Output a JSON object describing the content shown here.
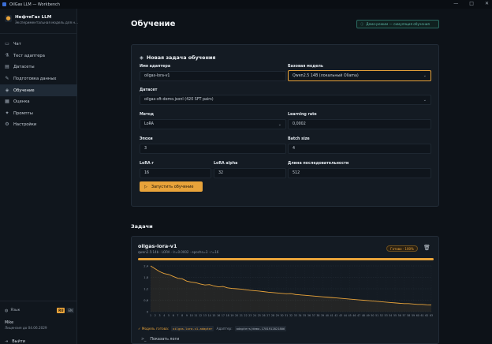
{
  "window": {
    "title": "OilGas LLM — Workbench",
    "controls": [
      "—",
      "□",
      "✕"
    ]
  },
  "brand": {
    "name": "НефтеГаз LLM",
    "subtitle": "Экспериментальная модель для н..."
  },
  "sidebar": {
    "items": [
      {
        "label": "Чат",
        "icon": "chat-icon",
        "active": false
      },
      {
        "label": "Тест адаптера",
        "icon": "beaker-icon",
        "active": false
      },
      {
        "label": "Датасеты",
        "icon": "database-icon",
        "active": false
      },
      {
        "label": "Подготовка данных",
        "icon": "wrench-icon",
        "active": false
      },
      {
        "label": "Обучение",
        "icon": "graduation-icon",
        "active": true
      },
      {
        "label": "Оценка",
        "icon": "chart-icon",
        "active": false
      },
      {
        "label": "Промпты",
        "icon": "prompt-icon",
        "active": false
      },
      {
        "label": "Настройки",
        "icon": "gear-icon",
        "active": false
      }
    ],
    "language_label": "Язык",
    "languages": [
      {
        "code": "RU",
        "active": true
      },
      {
        "code": "EN",
        "active": false
      }
    ],
    "user_name": "Mike",
    "license": "Лицензия до 04.06.2029",
    "logout_label": "Выйти"
  },
  "page": {
    "title": "Обучение",
    "demo_badge": "Демо-режим — симуляция обучения"
  },
  "form": {
    "title": "Новая задача обучения",
    "adapter_name_label": "Имя адаптера",
    "adapter_name_value": "oilgas-lora-v1",
    "base_model_label": "Базовая модель",
    "base_model_value": "Qwen2.5 14B (локальный Ollama)",
    "dataset_label": "Датасет",
    "dataset_value": "oilgas-sft-demo.jsonl (420 SFT pairs)",
    "method_label": "Метод",
    "method_value": "LoRA",
    "lr_label": "Learning rate",
    "lr_value": "0,0002",
    "epochs_label": "Эпохи",
    "epochs_value": "3",
    "batch_label": "Batch size",
    "batch_value": "4",
    "lora_r_label": "LoRA r",
    "lora_r_value": "16",
    "lora_alpha_label": "LoRA alpha",
    "lora_alpha_value": "32",
    "seq_len_label": "Длина последовательности",
    "seq_len_value": "512",
    "start_button": "Запустить обучение"
  },
  "jobs": {
    "title": "Задачи",
    "items": [
      {
        "name": "oilgas-lora-v1",
        "meta": "qwen2.5:14b · LORA · lr=0.0002 · epochs=3 · r=16",
        "status": "Готово · 100%",
        "progress_fraction": 1.0,
        "result_ready": "✓ Модель готова:",
        "result_model": "oilgas-lora-v1-adapter",
        "result_adapter_label": "Адаптер:",
        "result_adapter_path": "adapters/demo-1781912821806",
        "logs_label": "Показать логи"
      }
    ]
  },
  "chart_data": {
    "type": "line",
    "x": [
      1,
      2,
      3,
      4,
      5,
      6,
      7,
      8,
      9,
      10,
      11,
      12,
      13,
      14,
      15,
      16,
      17,
      18,
      19,
      20,
      21,
      22,
      23,
      24,
      25,
      26,
      27,
      28,
      29,
      30,
      31,
      32,
      33,
      34,
      35,
      36,
      37,
      38,
      39,
      40,
      41,
      42,
      43,
      44,
      45,
      46,
      47,
      48,
      49,
      50,
      51,
      52,
      53,
      54,
      55,
      56,
      57,
      58,
      59,
      60,
      61,
      62,
      63
    ],
    "values": [
      2.4,
      2.25,
      2.1,
      2.0,
      1.95,
      1.85,
      1.75,
      1.72,
      1.6,
      1.55,
      1.52,
      1.45,
      1.4,
      1.42,
      1.35,
      1.3,
      1.32,
      1.25,
      1.22,
      1.2,
      1.18,
      1.15,
      1.12,
      1.1,
      1.08,
      1.05,
      1.02,
      1.0,
      0.98,
      0.96,
      0.94,
      0.95,
      0.9,
      0.88,
      0.86,
      0.84,
      0.82,
      0.8,
      0.78,
      0.76,
      0.74,
      0.72,
      0.7,
      0.68,
      0.66,
      0.64,
      0.62,
      0.6,
      0.58,
      0.56,
      0.54,
      0.52,
      0.5,
      0.48,
      0.46,
      0.44,
      0.42,
      0.42,
      0.4,
      0.38,
      0.38,
      0.36,
      0.35
    ],
    "ylim": [
      0,
      2.4
    ],
    "yticks": [
      "2,4",
      "1,8",
      "1,2",
      "0,6",
      "0"
    ],
    "xticks": [
      "1",
      "2",
      "3",
      "4",
      "5",
      "6",
      "7",
      "8",
      "9",
      "10",
      "11",
      "12",
      "13",
      "14",
      "15",
      "16",
      "17",
      "18",
      "19",
      "20",
      "21",
      "22",
      "23",
      "24",
      "25",
      "26",
      "27",
      "28",
      "29",
      "30",
      "31",
      "32",
      "33",
      "34",
      "35",
      "36",
      "37",
      "38",
      "39",
      "40",
      "41",
      "42",
      "43",
      "44",
      "45",
      "46",
      "47",
      "48",
      "49",
      "50",
      "51",
      "52",
      "53",
      "54",
      "55",
      "56",
      "57",
      "58",
      "59",
      "60",
      "61",
      "62",
      "63"
    ],
    "grid": true,
    "color": "#e8a33a"
  }
}
